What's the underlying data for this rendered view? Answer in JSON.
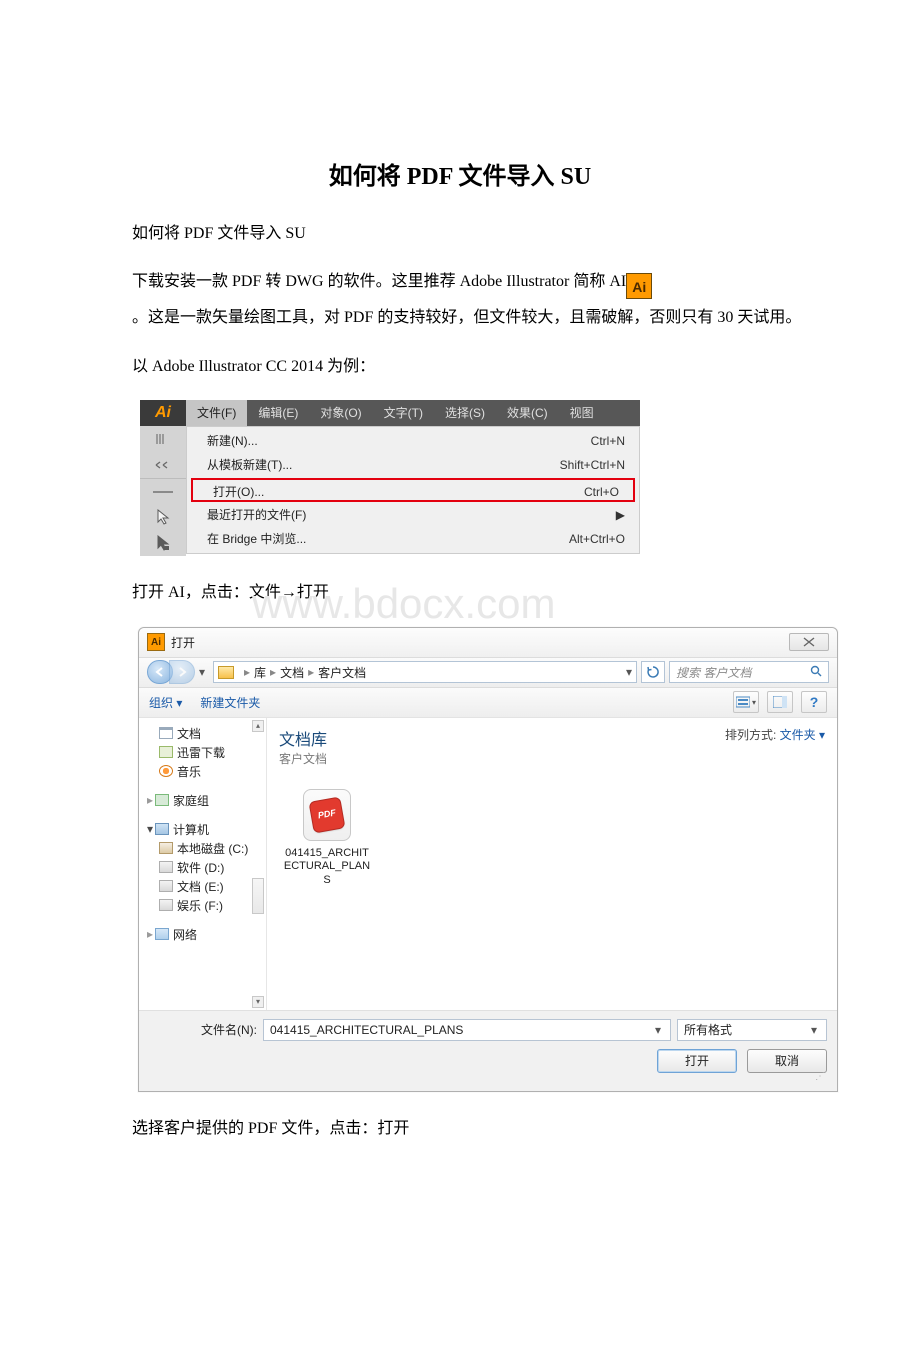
{
  "doc": {
    "title": "如何将 PDF 文件导入 SU",
    "p1": "如何将 PDF 文件导入 SU",
    "p2a": "下载安装一款 PDF 转 DWG 的软件。这里推荐 Adobe Illustrator 简称 AI",
    "p2icon": "Ai",
    "p3": "。这是一款矢量绘图工具，对 PDF 的支持较好，但文件较大，且需破解，否则只有 30 天试用。",
    "p4": "以 Adobe Illustrator CC 2014 为例：",
    "p5": "打开 AI，点击：文件→打开",
    "p6": "选择客户提供的 PDF 文件，点击：打开",
    "watermark": "www.bdocx.com"
  },
  "menu": {
    "corner": "Ai",
    "items": [
      "文件(F)",
      "编辑(E)",
      "对象(O)",
      "文字(T)",
      "选择(S)",
      "效果(C)",
      "视图"
    ],
    "rows": [
      {
        "label": "新建(N)...",
        "shortcut": "Ctrl+N"
      },
      {
        "label": "从模板新建(T)...",
        "shortcut": "Shift+Ctrl+N"
      },
      {
        "label": "打开(O)...",
        "shortcut": "Ctrl+O",
        "hl": true
      },
      {
        "label": "最近打开的文件(F)",
        "shortcut": "",
        "submenu": true
      },
      {
        "label": "在 Bridge 中浏览...",
        "shortcut": "Alt+Ctrl+O"
      }
    ]
  },
  "dlg": {
    "title": "打开",
    "ai_badge": "Ai",
    "crumb_parts": [
      "库",
      "文档",
      "客户文档"
    ],
    "search_placeholder": "搜索 客户文档",
    "org": "组织 ▾",
    "newf": "新建文件夹",
    "tree": {
      "docs": "文档",
      "xunlei": "迅雷下载",
      "music": "音乐",
      "home": "家庭组",
      "computer": "计算机",
      "drive_c": "本地磁盘 (C:)",
      "drive_d": "软件 (D:)",
      "drive_e": "文档 (E:)",
      "drive_f": "娱乐 (F:)",
      "network": "网络"
    },
    "lib_title": "文档库",
    "lib_sub": "客户文档",
    "arrange_label": "排列方式:",
    "arrange_value": "文件夹 ▾",
    "pdf_badge": "PDF",
    "file_name_lines": [
      "041415_ARCHIT",
      "ECTURAL_PLAN",
      "S"
    ],
    "fn_label": "文件名(N):",
    "fn_value": "041415_ARCHITECTURAL_PLANS",
    "filter": "所有格式",
    "open": "打开",
    "cancel": "取消"
  }
}
